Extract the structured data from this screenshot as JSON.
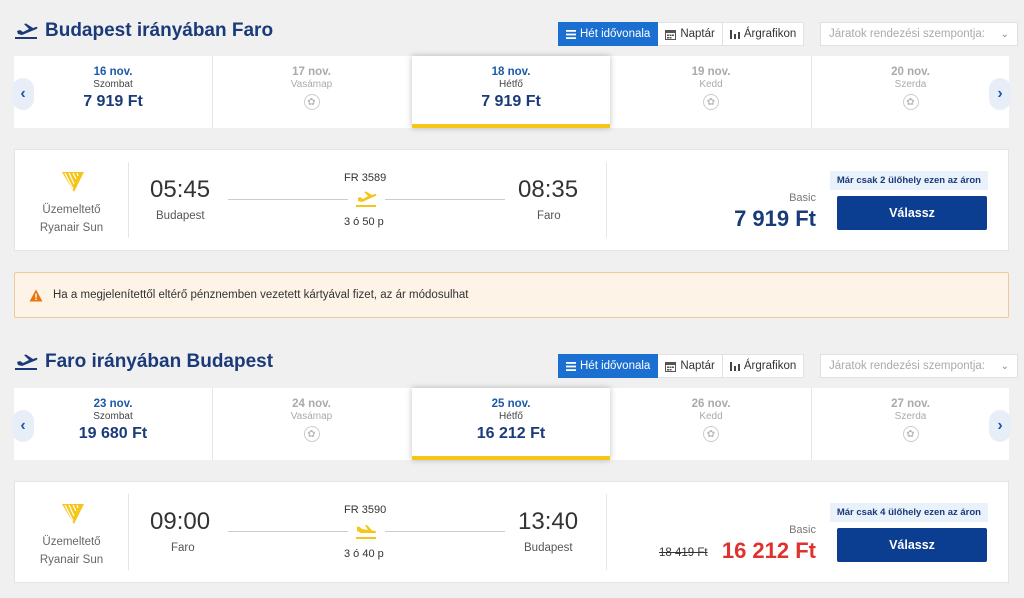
{
  "colors": {
    "primary": "#1a3a7a",
    "accent_blue": "#1a6fd0",
    "button": "#0b3d91",
    "selected_underline": "#f5c518",
    "price_red": "#e0322c",
    "warning": "#e8750b"
  },
  "view_toggle": {
    "timeline": "Hét idővonala",
    "calendar": "Naptár",
    "chart": "Árgrafikon"
  },
  "sort_placeholder": "Járatok rendezési szempontja:",
  "outbound": {
    "title": "Budapest irányában Faro",
    "dates": [
      {
        "date": "16 nov.",
        "weekday": "Szombat",
        "price": "7 919 Ft",
        "available": true,
        "selected": false
      },
      {
        "date": "17 nov.",
        "weekday": "Vasámap",
        "price": "",
        "available": false,
        "selected": false
      },
      {
        "date": "18 nov.",
        "weekday": "Hétfő",
        "price": "7 919 Ft",
        "available": true,
        "selected": true
      },
      {
        "date": "19 nov.",
        "weekday": "Kedd",
        "price": "",
        "available": false,
        "selected": false
      },
      {
        "date": "20 nov.",
        "weekday": "Szerda",
        "price": "",
        "available": false,
        "selected": false
      }
    ],
    "flight": {
      "operator_label": "Üzemeltető",
      "operator": "Ryanair Sun",
      "departure_time": "05:45",
      "departure_city": "Budapest",
      "flight_number": "FR 3589",
      "duration": "3 ó 50 p",
      "arrival_time": "08:35",
      "arrival_city": "Faro",
      "seats_badge": "Már csak 2 ülőhely ezen az áron",
      "fare": "Basic",
      "price": "7 919 Ft",
      "select_label": "Válassz"
    }
  },
  "notice": {
    "icon": "warning-icon",
    "text": "Ha a megjelenítettől eltérő pénznemben vezetett kártyával fizet, az ár módosulhat"
  },
  "inbound": {
    "title": "Faro irányában Budapest",
    "dates": [
      {
        "date": "23 nov.",
        "weekday": "Szombat",
        "price": "19 680 Ft",
        "available": true,
        "selected": false
      },
      {
        "date": "24 nov.",
        "weekday": "Vasámap",
        "price": "",
        "available": false,
        "selected": false
      },
      {
        "date": "25 nov.",
        "weekday": "Hétfő",
        "price": "16 212 Ft",
        "available": true,
        "selected": true
      },
      {
        "date": "26 nov.",
        "weekday": "Kedd",
        "price": "",
        "available": false,
        "selected": false
      },
      {
        "date": "27 nov.",
        "weekday": "Szerda",
        "price": "",
        "available": false,
        "selected": false
      }
    ],
    "flight": {
      "operator_label": "Üzemeltető",
      "operator": "Ryanair Sun",
      "departure_time": "09:00",
      "departure_city": "Faro",
      "flight_number": "FR 3590",
      "duration": "3 ó 40 p",
      "arrival_time": "13:40",
      "arrival_city": "Budapest",
      "seats_badge": "Már csak 4 ülőhely ezen az áron",
      "fare": "Basic",
      "old_price": "18 419 Ft",
      "price": "16 212 Ft",
      "select_label": "Válassz"
    }
  }
}
